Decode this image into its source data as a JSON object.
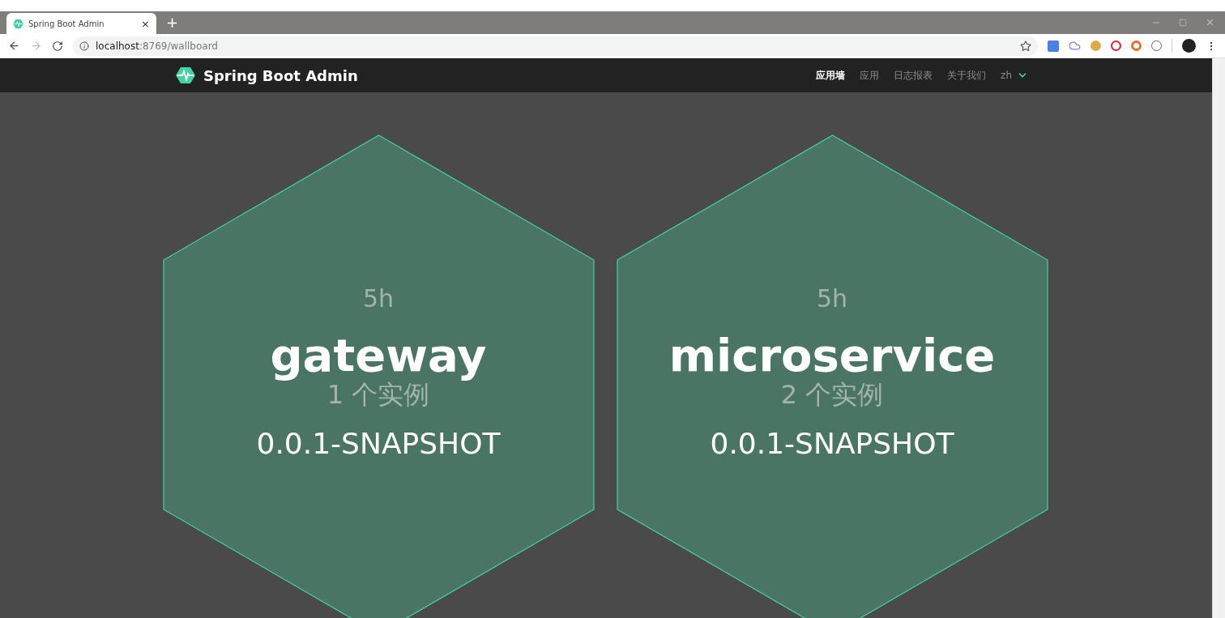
{
  "browser": {
    "tab": {
      "title": "Spring Boot Admin",
      "close": "×"
    },
    "new_tab": "+",
    "url": {
      "host": "localhost",
      "rest": ":8769/wallboard"
    }
  },
  "navbar": {
    "brand": "Spring Boot Admin",
    "items": [
      {
        "label": "应用墙",
        "selected": true
      },
      {
        "label": "应用",
        "selected": false
      },
      {
        "label": "日志报表",
        "selected": false
      },
      {
        "label": "关于我们",
        "selected": false
      }
    ],
    "language": "zh"
  },
  "applications": [
    {
      "uptime": "5h",
      "name": "gateway",
      "instances": "1 个实例",
      "version": "0.0.1-SNAPSHOT"
    },
    {
      "uptime": "5h",
      "name": "microservice",
      "instances": "2 个实例",
      "version": "0.0.1-SNAPSHOT"
    }
  ]
}
